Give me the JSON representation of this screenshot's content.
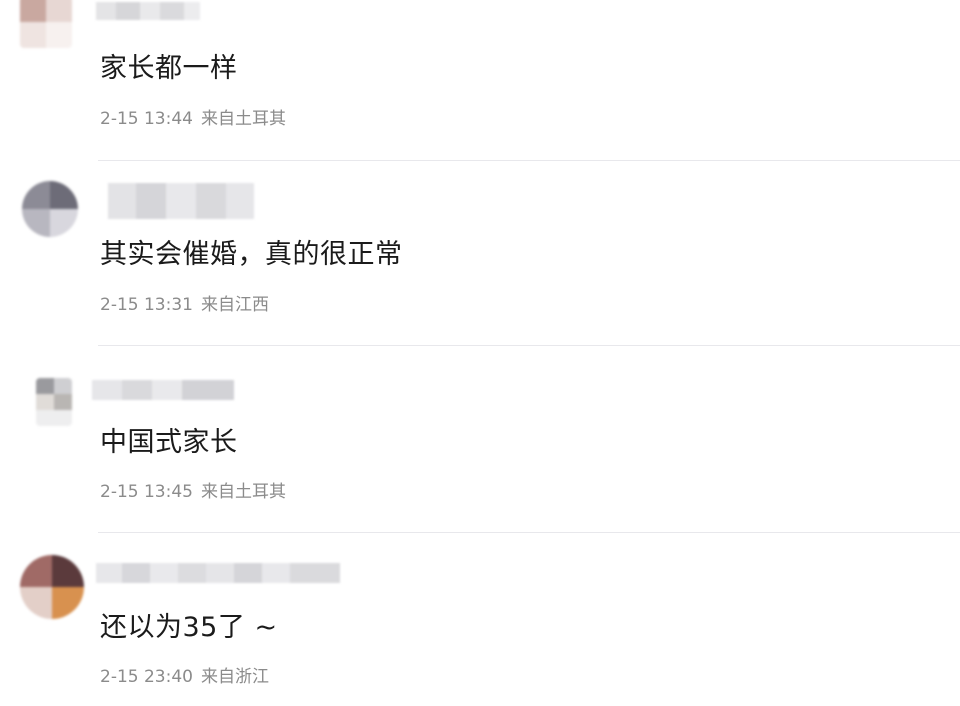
{
  "comments": [
    {
      "avatar": "blurred-avatar",
      "username": "",
      "text": "家长都一样",
      "time": "2-15 13:44",
      "location": "来自土耳其"
    },
    {
      "avatar": "blurred-avatar",
      "username": "",
      "text": "其实会催婚，真的很正常",
      "time": "2-15 13:31",
      "location": "来自江西"
    },
    {
      "avatar": "blurred-avatar",
      "username": "",
      "text": "中国式家长",
      "time": "2-15 13:45",
      "location": "来自土耳其"
    },
    {
      "avatar": "blurred-avatar",
      "username": "",
      "text": "还以为35了 ~",
      "time": "2-15 23:40",
      "location": "来自浙江"
    }
  ]
}
